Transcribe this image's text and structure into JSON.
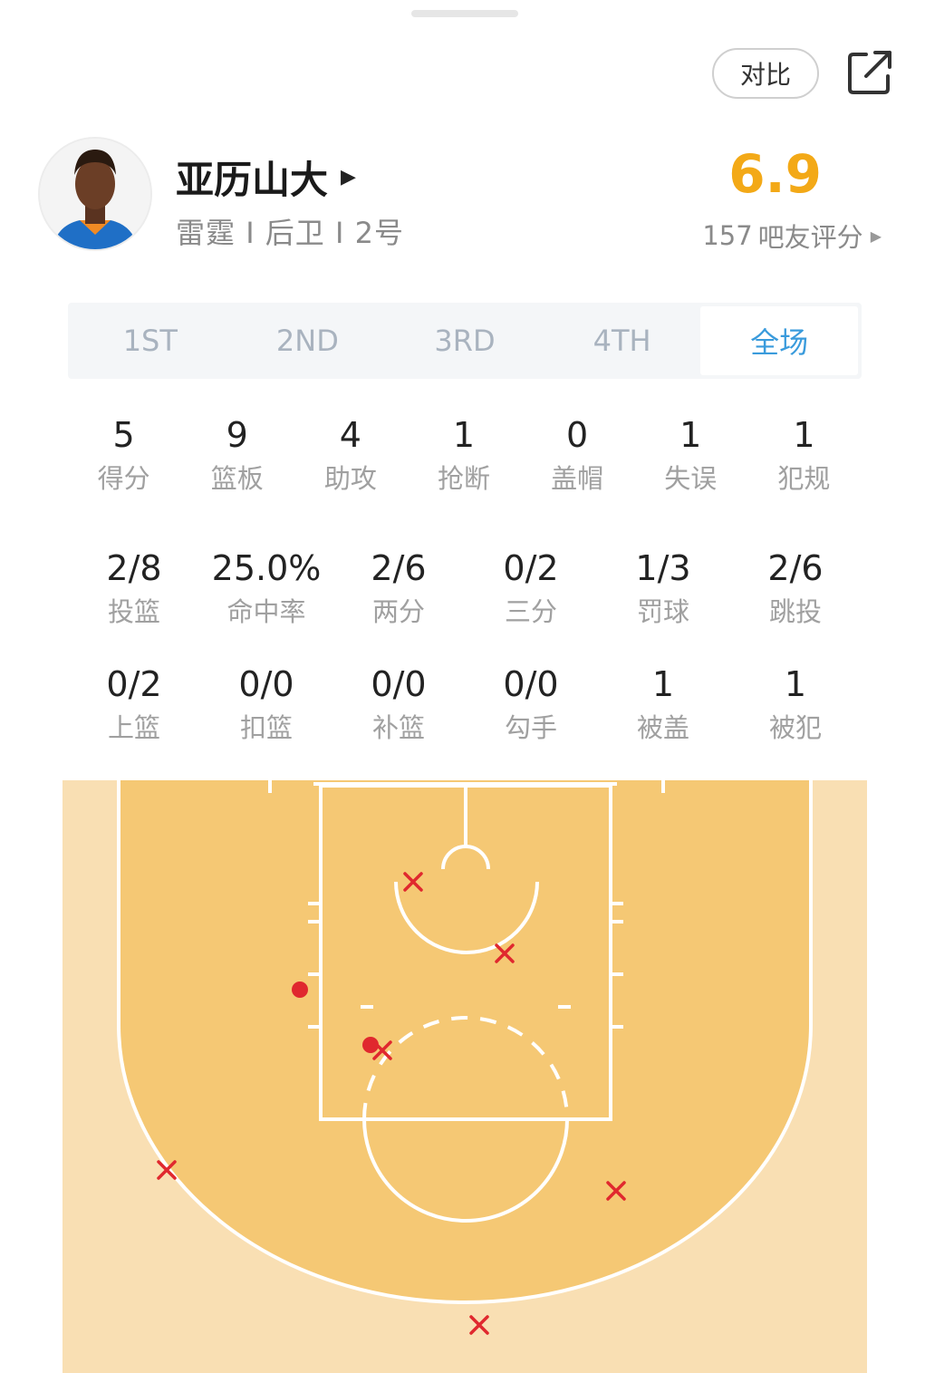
{
  "header": {
    "compare_label": "对比"
  },
  "player": {
    "name": "亚历山大",
    "team": "雷霆",
    "position": "后卫",
    "number": "2号",
    "rating": "6.9",
    "rating_count": "157",
    "rating_label": "吧友评分"
  },
  "tabs": [
    {
      "label": "1ST",
      "active": false
    },
    {
      "label": "2ND",
      "active": false
    },
    {
      "label": "3RD",
      "active": false
    },
    {
      "label": "4TH",
      "active": false
    },
    {
      "label": "全场",
      "active": true
    }
  ],
  "basic_stats": [
    {
      "value": "5",
      "label": "得分"
    },
    {
      "value": "9",
      "label": "篮板"
    },
    {
      "value": "4",
      "label": "助攻"
    },
    {
      "value": "1",
      "label": "抢断"
    },
    {
      "value": "0",
      "label": "盖帽"
    },
    {
      "value": "1",
      "label": "失误"
    },
    {
      "value": "1",
      "label": "犯规"
    }
  ],
  "shooting_stats": [
    {
      "value": "2/8",
      "label": "投篮"
    },
    {
      "value": "25.0%",
      "label": "命中率"
    },
    {
      "value": "2/6",
      "label": "两分"
    },
    {
      "value": "0/2",
      "label": "三分"
    },
    {
      "value": "1/3",
      "label": "罚球"
    },
    {
      "value": "2/6",
      "label": "跳投"
    }
  ],
  "detail_stats": [
    {
      "value": "0/2",
      "label": "上篮"
    },
    {
      "value": "0/0",
      "label": "扣篮"
    },
    {
      "value": "0/0",
      "label": "补篮"
    },
    {
      "value": "0/0",
      "label": "勾手"
    },
    {
      "value": "1",
      "label": "被盖"
    },
    {
      "value": "1",
      "label": "被犯"
    }
  ],
  "colors": {
    "court_inner": "#f5c874",
    "court_outer": "#f9dfb3",
    "made": "#e0282e",
    "missed": "#e0282e",
    "rating": "#f3a917",
    "tab_active": "#3a9bdc"
  },
  "shot_legend": {
    "made_marker": "dot",
    "missed_marker": "cross"
  }
}
